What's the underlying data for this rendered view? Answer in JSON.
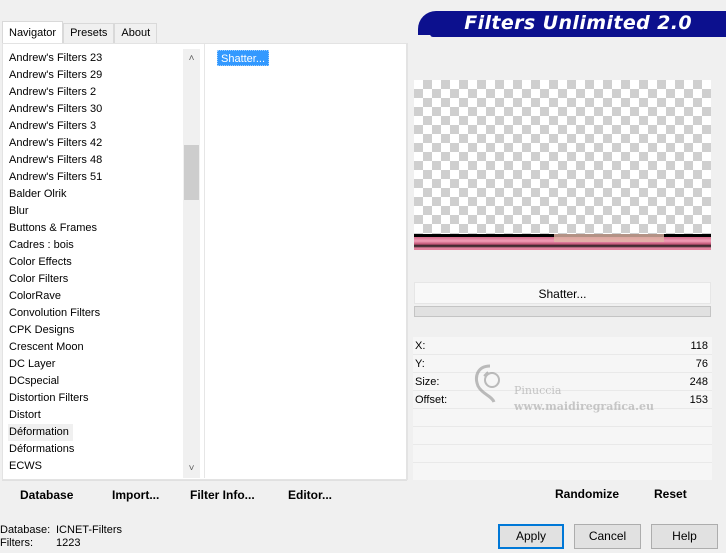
{
  "tabs": [
    "Navigator",
    "Presets",
    "About"
  ],
  "banner_title": "Filters Unlimited 2.0",
  "categories": [
    "Andrew's Filters 23",
    "Andrew's Filters 29",
    "Andrew's Filters 2",
    "Andrew's Filters 30",
    "Andrew's Filters 3",
    "Andrew's Filters 42",
    "Andrew's Filters 48",
    "Andrew's Filters 51",
    "Balder Olrik",
    "Blur",
    "Buttons & Frames",
    "Cadres : bois",
    "Color Effects",
    "Color Filters",
    "ColorRave",
    "Convolution Filters",
    "CPK Designs",
    "Crescent Moon",
    "DC Layer",
    "DCspecial",
    "Distortion Filters",
    "Distort",
    "Déformation",
    "Déformations",
    "ECWS"
  ],
  "selected_category": "Déformation",
  "filter_item": "Shatter...",
  "preview_filter_label": "Shatter...",
  "params": [
    {
      "label": "X:",
      "value": "118"
    },
    {
      "label": "Y:",
      "value": "76"
    },
    {
      "label": "Size:",
      "value": "248"
    },
    {
      "label": "Offset:",
      "value": "153"
    }
  ],
  "watermark": {
    "name": "Pinuccia",
    "url": "www.maidiregrafica.eu"
  },
  "bottom_buttons": {
    "database": "Database",
    "import": "Import...",
    "filter_info": "Filter Info...",
    "editor": "Editor...",
    "randomize": "Randomize",
    "reset": "Reset"
  },
  "status": {
    "database_label": "Database:",
    "database_value": "ICNET-Filters",
    "filters_label": "Filters:",
    "filters_value": "1223"
  },
  "dialog_buttons": {
    "apply": "Apply",
    "cancel": "Cancel",
    "help": "Help"
  },
  "colors": {
    "banner": "#0c108e",
    "selection": "#3399ff"
  },
  "icons": {
    "scroll_up": "chevron-up-icon",
    "scroll_down": "chevron-down-icon"
  }
}
